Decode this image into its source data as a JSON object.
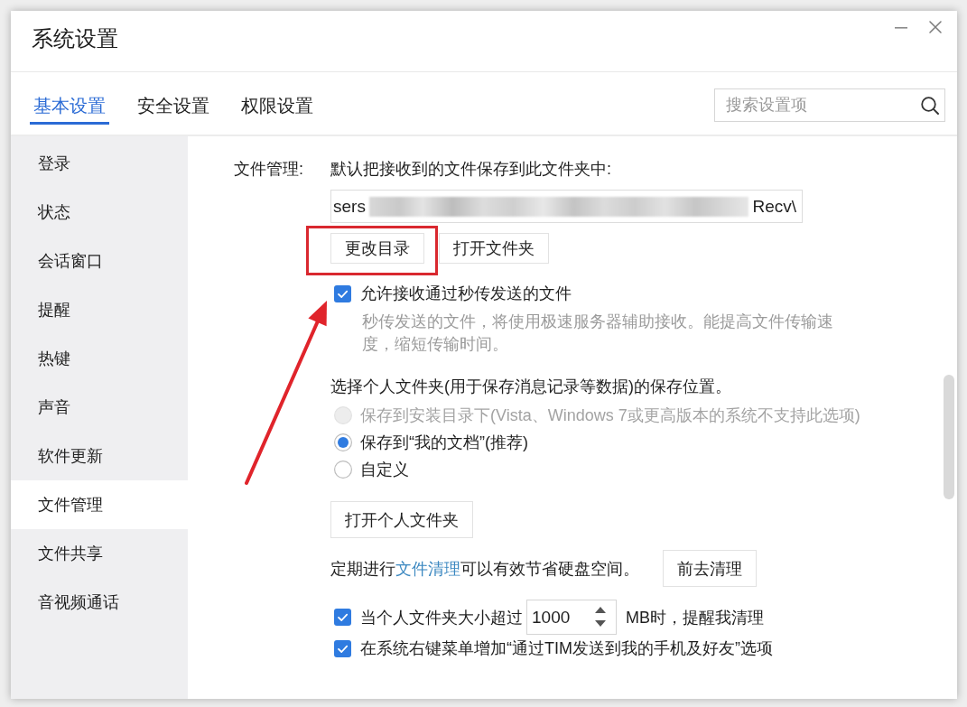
{
  "window": {
    "title": "系统设置"
  },
  "tabs": [
    {
      "label": "基本设置",
      "selected": true
    },
    {
      "label": "安全设置",
      "selected": false
    },
    {
      "label": "权限设置",
      "selected": false
    }
  ],
  "search": {
    "placeholder": "搜索设置项"
  },
  "sidebar": {
    "items": [
      {
        "label": "登录",
        "selected": false
      },
      {
        "label": "状态",
        "selected": false
      },
      {
        "label": "会话窗口",
        "selected": false
      },
      {
        "label": "提醒",
        "selected": false
      },
      {
        "label": "热键",
        "selected": false
      },
      {
        "label": "声音",
        "selected": false
      },
      {
        "label": "软件更新",
        "selected": false
      },
      {
        "label": "文件管理",
        "selected": true
      },
      {
        "label": "文件共享",
        "selected": false
      },
      {
        "label": "音视频通话",
        "selected": false
      }
    ]
  },
  "file_management": {
    "label": "文件管理:",
    "receive_folder": {
      "description": "默认把接收到的文件保存到此文件夹中:",
      "path_start": "sers",
      "path_end": "Recv\\",
      "buttons": [
        "更改目录",
        "打开文件夹"
      ]
    },
    "fast_transfer": {
      "label": "允许接收通过秒传发送的文件",
      "checked": true,
      "hint": "秒传发送的文件，将使用极速服务器辅助接收。能提高文件传输速度，缩短传输时间。"
    },
    "personal_folder": {
      "heading": "选择个人文件夹(用于保存消息记录等数据)的保存位置。",
      "options": [
        {
          "label": "保存到安装目录下(Vista、Windows 7或更高版本的系统不支持此选项)",
          "selected": false,
          "disabled": true
        },
        {
          "label": "保存到“我的文档”(推荐)",
          "selected": true,
          "disabled": false
        },
        {
          "label": "自定义",
          "selected": false,
          "disabled": false
        }
      ],
      "button": "打开个人文件夹"
    },
    "cleanup": {
      "text_before": "定期进行",
      "link": "文件清理",
      "text_after": "可以有效节省硬盘空间。",
      "button": "前去清理"
    },
    "size_reminder": {
      "checked": true,
      "label_before": "当个人文件夹大小超过",
      "value": "1000",
      "label_after": "MB时，提醒我清理"
    },
    "context_menu": {
      "checked": true,
      "label": "在系统右键菜单增加“通过TIM发送到我的手机及好友”选项"
    }
  }
}
